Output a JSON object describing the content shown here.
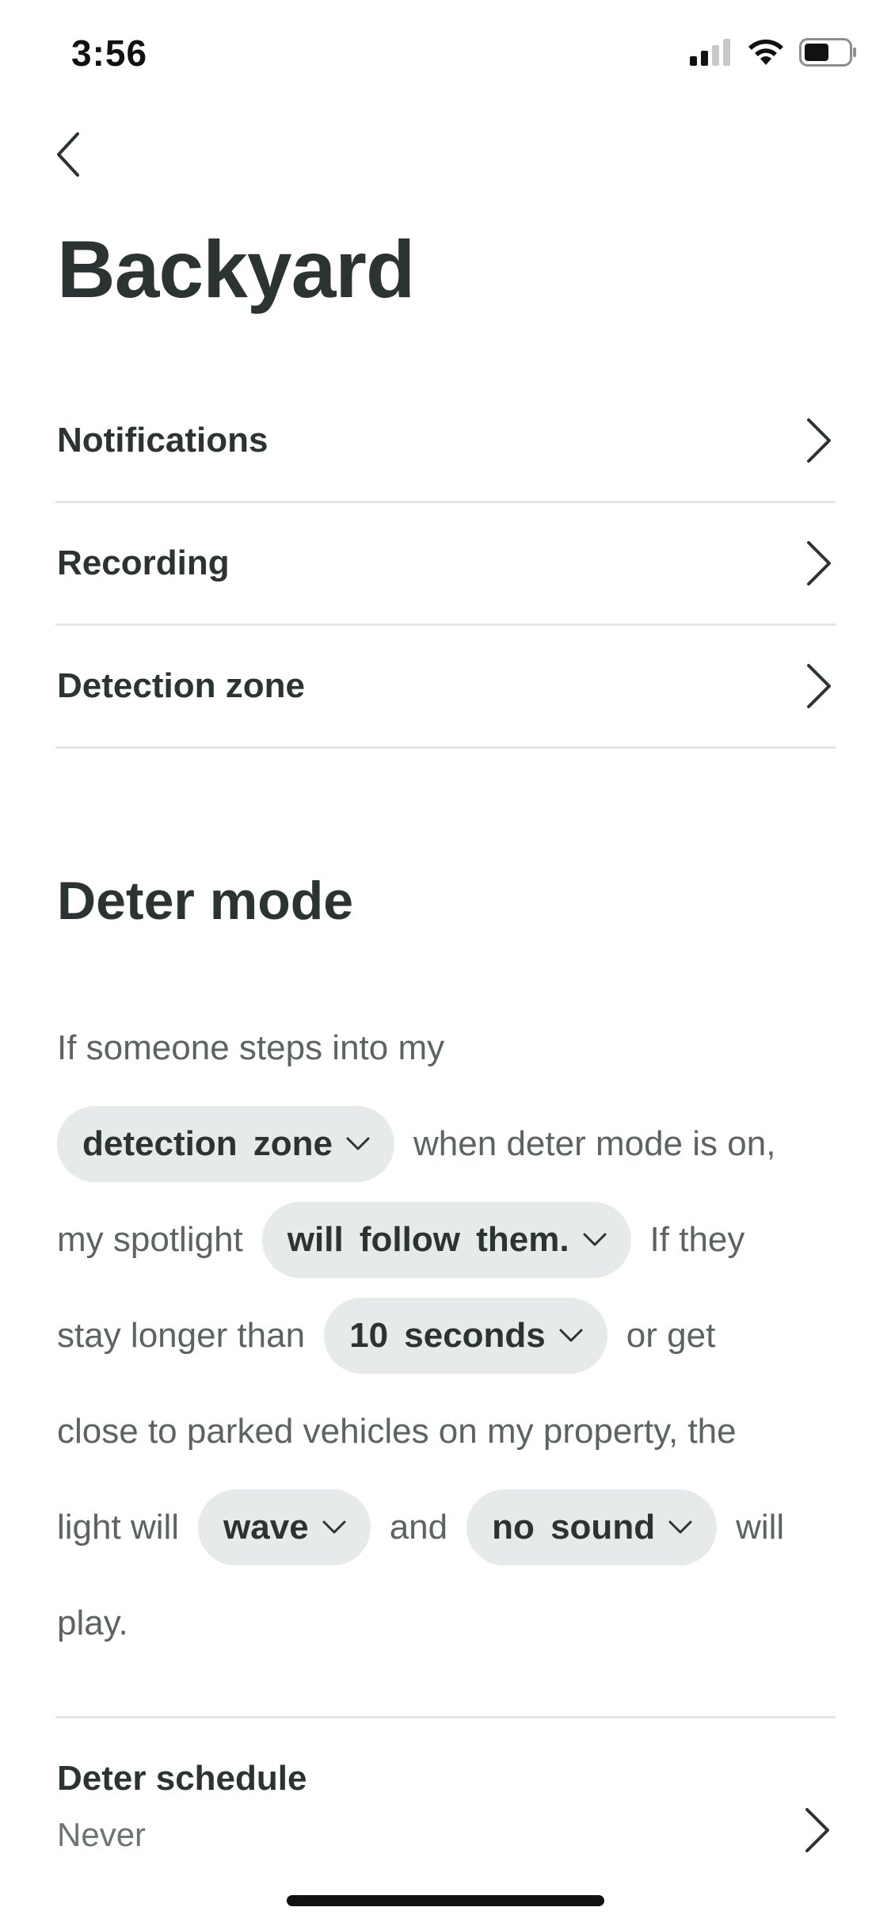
{
  "status_bar": {
    "time": "3:56",
    "icons": [
      "cellular-signal-icon",
      "wifi-icon",
      "battery-icon"
    ]
  },
  "header": {
    "back_icon": "chevron-left-icon",
    "title": "Backyard"
  },
  "settings": [
    {
      "label": "Notifications"
    },
    {
      "label": "Recording"
    },
    {
      "label": "Detection zone"
    }
  ],
  "deter_mode": {
    "title": "Deter mode",
    "sentence": {
      "t1": "If someone steps into my",
      "chip_zone": "detection zone",
      "t2": "when deter mode is on,",
      "t3": "my spotlight",
      "chip_follow": "will follow them.",
      "t4": "If they",
      "t5": "stay longer than",
      "chip_seconds": "10 seconds",
      "t6": "or get",
      "t7": "close to parked vehicles on my property, the",
      "t8": "light will",
      "chip_light": "wave",
      "t9": "and",
      "chip_sound": "no sound",
      "t10": "will",
      "t11": "play."
    }
  },
  "deter_schedule": {
    "label": "Deter schedule",
    "value": "Never"
  },
  "colors": {
    "text_primary": "#2b3432",
    "text_secondary": "#5b6462",
    "chip_bg": "#e7eaea",
    "divider": "#e2e5e4"
  }
}
